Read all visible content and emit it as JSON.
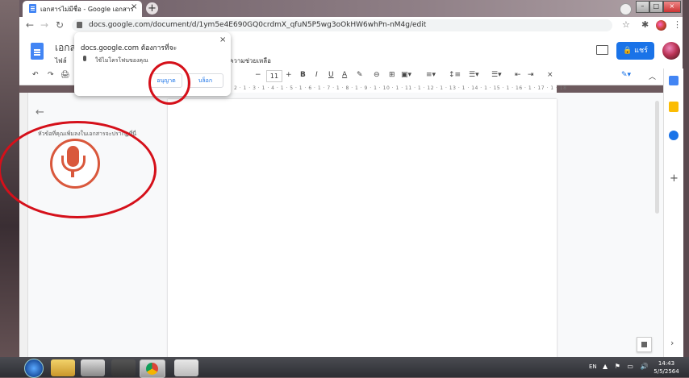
{
  "browser": {
    "tab_title": "เอกสารไม่มีชื่อ - Google เอกสาร",
    "tab_close": "×",
    "new_tab": "+",
    "url": "docs.google.com/document/d/1ym5e4E690GQ0crdmX_qfuN5P5wg3oOkHW6whPn-nM4g/edit",
    "window_buttons": [
      "–",
      "□",
      "×"
    ]
  },
  "docs": {
    "title_partial": "เอกส",
    "menu_file_partial": "ไฟล์",
    "menu_help_partial": "ความช่วยเหลือ",
    "share_label": "แชร์",
    "font_size": "11",
    "toolbar_items": [
      "↶",
      "↷",
      "🖨",
      "−",
      "+",
      "B",
      "I",
      "U",
      "A"
    ],
    "ruler_text": "2 · 1 · 3 · 1 · 4 · 1 · 5 · 1 · 6 · 1 · 7 · 1 · 8 · 1 · 9 · 1 · 10 · 1 · 11 · 1 · 12 · 1 · 13 · 1 · 14 · 1 · 15 · 1 · 16 · 1 · 17 · 1 · 18",
    "outline_text": "หัวข้อที่คุณเพิ่มลงในเอกสารจะปรากฏที่นี่"
  },
  "permission_popup": {
    "title": "docs.google.com ต้องการที่จะ",
    "description": "ใช้ไมโครโฟนของคุณ",
    "allow_label": "อนุญาต",
    "block_label": "บล็อก",
    "close": "×"
  },
  "taskbar": {
    "lang": "EN",
    "tray": "▲ ⚑ ▭ 🔊",
    "time": "14:43",
    "date": "5/5/2564"
  },
  "colors": {
    "accent": "#1a73e8",
    "annotation": "#d5101a",
    "mic": "#d9583c"
  }
}
